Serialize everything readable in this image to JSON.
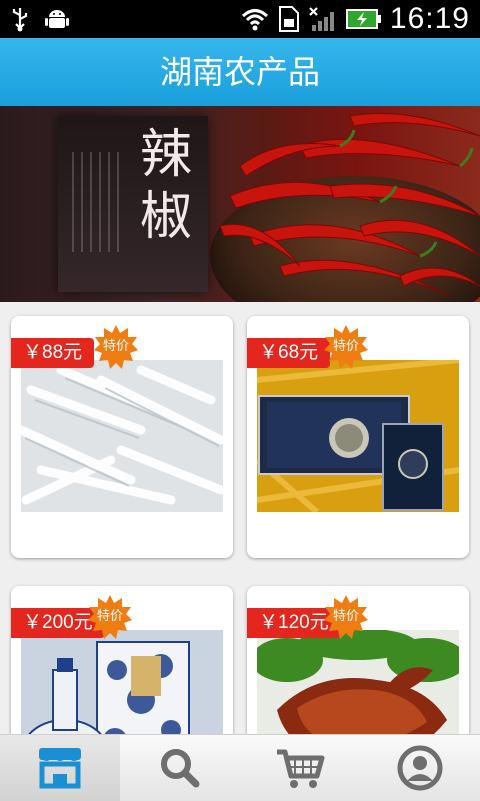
{
  "status": {
    "time": "16:19"
  },
  "header": {
    "title": "湖南农产品"
  },
  "banner": {
    "calligraphy": "辣椒",
    "slide_index": 1,
    "slide_count": 2
  },
  "products": [
    {
      "price": "￥88元",
      "badge": "特价",
      "image": "white-rice-noodles"
    },
    {
      "price": "￥68元",
      "badge": "特价",
      "image": "cigarette-box"
    },
    {
      "price": "￥200元",
      "badge": "特价",
      "image": "blue-white-porcelain-liquor"
    },
    {
      "price": "￥120元",
      "badge": "特价",
      "image": "roast-duck"
    }
  ],
  "nav": [
    {
      "icon": "shop-icon",
      "active": true
    },
    {
      "icon": "search-icon",
      "active": false
    },
    {
      "icon": "cart-icon",
      "active": false
    },
    {
      "icon": "profile-icon",
      "active": false
    }
  ],
  "colors": {
    "title_bar": "#1a9fdb",
    "price_tag": "#e3261e",
    "badge": "#f07d12"
  }
}
